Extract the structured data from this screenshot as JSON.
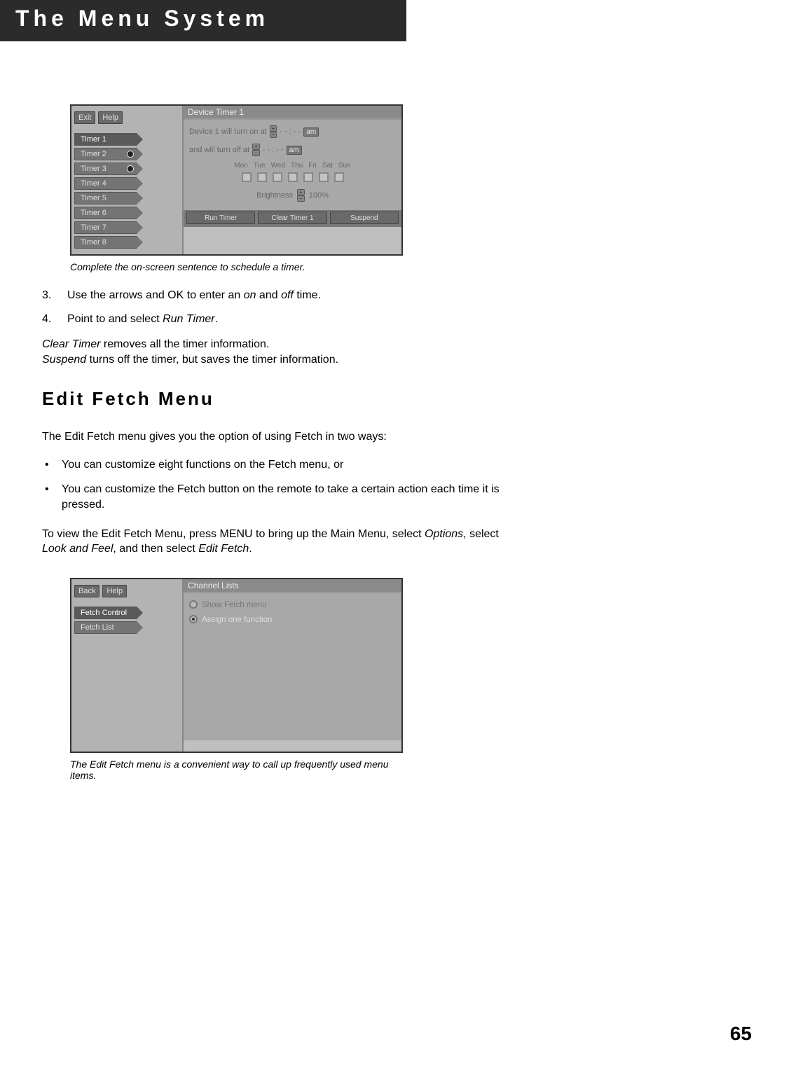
{
  "header": {
    "title": "The Menu System"
  },
  "screenshot1": {
    "topButtons": [
      "Exit",
      "Help"
    ],
    "timers": [
      "Timer 1",
      "Timer 2",
      "Timer 3",
      "Timer 4",
      "Timer 5",
      "Timer 6",
      "Timer 7",
      "Timer 8"
    ],
    "panelTitle": "Device Timer 1",
    "onText": "Device 1 will turn on at",
    "offText": "and will turn off at",
    "timePlaceholder": "- - : - -",
    "ampm": "am",
    "days": [
      "Mon",
      "Tue",
      "Wed",
      "Thu",
      "Fri",
      "Sat",
      "Sun"
    ],
    "brightnessLabel": "Brightness",
    "brightnessValue": "100%",
    "bottomButtons": [
      "Run Timer",
      "Clear Timer 1",
      "Suspend"
    ],
    "caption": "Complete the on-screen sentence to schedule a timer."
  },
  "steps": [
    {
      "num": "3.",
      "before": "Use the arrows and OK to enter an ",
      "i1": "on",
      "mid": " and ",
      "i2": "off",
      "after": " time."
    },
    {
      "num": "4.",
      "before": "Point to and select ",
      "i1": "Run Timer",
      "mid": "",
      "i2": "",
      "after": "."
    }
  ],
  "clearSuspend": {
    "clearTerm": "Clear Timer",
    "clearRest": " removes all the timer information.",
    "suspendTerm": "Suspend",
    "suspendRest": " turns off the timer, but saves the timer information."
  },
  "section": {
    "title": "Edit Fetch Menu",
    "intro": "The Edit Fetch menu gives you the option of using Fetch in two ways:",
    "bullets": [
      "You can customize eight functions on the Fetch menu, or",
      "You can customize the Fetch button on the remote to take a certain action each time it is pressed."
    ],
    "howto_before": "To view the Edit Fetch Menu, press MENU to bring up the Main Menu, select ",
    "howto_i1": "Options",
    "howto_mid1": ", select ",
    "howto_i2": "Look and Feel",
    "howto_mid2": ", and then select ",
    "howto_i3": "Edit Fetch",
    "howto_after": "."
  },
  "screenshot2": {
    "topButtons": [
      "Back",
      "Help"
    ],
    "tabs": [
      "Fetch Control",
      "Fetch List"
    ],
    "panelTitle": "Channel Lists",
    "options": [
      {
        "label": "Show Fetch menu",
        "selected": false
      },
      {
        "label": "Assign one function",
        "selected": true
      }
    ],
    "caption": "The Edit Fetch menu is a convenient way to call up frequently used menu items."
  },
  "pageNumber": "65"
}
